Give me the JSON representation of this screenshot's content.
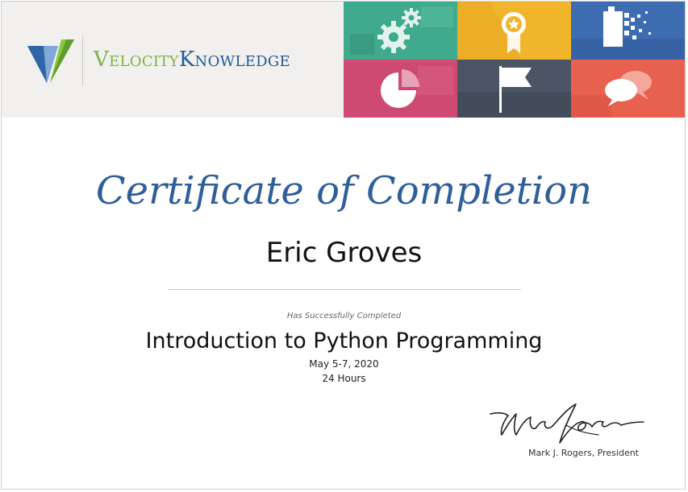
{
  "header": {
    "brand": {
      "first": "Velocity",
      "second": "Knowledge"
    },
    "tiles": [
      {
        "name": "gears-tile",
        "color": "#3faa8c",
        "icon": "gears-icon"
      },
      {
        "name": "award-tile",
        "color": "#f1b52b",
        "icon": "award-ribbon-icon"
      },
      {
        "name": "pixel-tile",
        "color": "#3e6cb1",
        "icon": "pixel-dissolve-icon"
      },
      {
        "name": "pie-tile",
        "color": "#cf4a72",
        "icon": "pie-chart-icon"
      },
      {
        "name": "flag-tile",
        "color": "#4b5566",
        "icon": "flag-icon"
      },
      {
        "name": "chat-tile",
        "color": "#e8604e",
        "icon": "speech-bubbles-icon"
      }
    ]
  },
  "certificate": {
    "title": "Certificate of Completion",
    "recipient": "Eric Groves",
    "completed_label": "Has Successfully Completed",
    "course": "Introduction to Python Programming",
    "dates": "May 5-7, 2020",
    "hours": "24 Hours",
    "signer": "Mark J. Rogers, President"
  },
  "colors": {
    "title": "#2f5f9a",
    "brand_green": "#7cb342",
    "brand_blue": "#1f5a96",
    "header_bg": "#f1f0ee"
  }
}
